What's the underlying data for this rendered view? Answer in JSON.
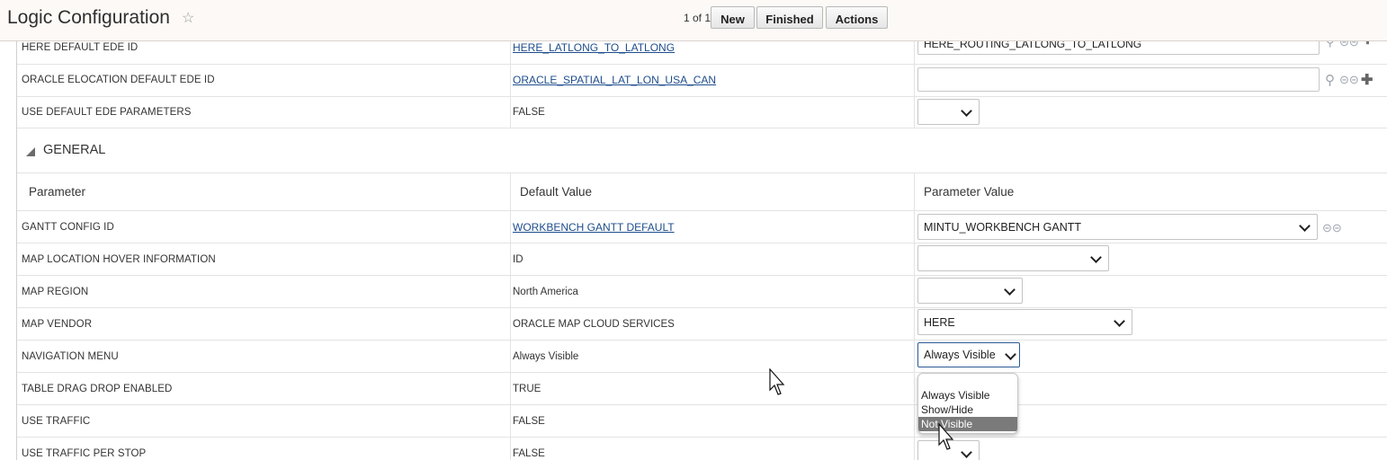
{
  "header": {
    "title": "Logic Configuration",
    "pager": "1 of 1",
    "buttons": {
      "new": "New",
      "finished": "Finished",
      "actions": "Actions"
    }
  },
  "top_rows": [
    {
      "param": "HERE DEFAULT EDE ID",
      "default": "HERE_LATLONG_TO_LATLONG",
      "value": "HERE_ROUTING_LATLONG_TO_LATLONG"
    },
    {
      "param": "ORACLE ELOCATION DEFAULT EDE ID",
      "default": "ORACLE_SPATIAL_LAT_LON_USA_CAN",
      "value": ""
    },
    {
      "param": "USE DEFAULT EDE PARAMETERS",
      "default": "FALSE",
      "value": ""
    }
  ],
  "section": {
    "title": "GENERAL",
    "columns": {
      "param": "Parameter",
      "default": "Default Value",
      "value": "Parameter Value"
    }
  },
  "rows": [
    {
      "param": "GANTT CONFIG ID",
      "default": "WORKBENCH GANTT DEFAULT",
      "value": "MINTU_WORKBENCH GANTT"
    },
    {
      "param": "MAP LOCATION HOVER INFORMATION",
      "default": "ID",
      "value": ""
    },
    {
      "param": "MAP REGION",
      "default": "North America",
      "value": ""
    },
    {
      "param": "MAP VENDOR",
      "default": "ORACLE MAP CLOUD SERVICES",
      "value": "HERE"
    },
    {
      "param": "NAVIGATION MENU",
      "default": "Always Visible",
      "value": "Always Visible"
    },
    {
      "param": "TABLE DRAG DROP ENABLED",
      "default": "TRUE",
      "value": ""
    },
    {
      "param": "USE TRAFFIC",
      "default": "FALSE",
      "value": ""
    },
    {
      "param": "USE TRAFFIC PER STOP",
      "default": "FALSE",
      "value": ""
    }
  ],
  "dropdown_options": [
    "Always Visible",
    "Show/Hide",
    "Not Visible"
  ],
  "highlighted_option": "Not Visible",
  "icons": [
    "star-icon",
    "search-icon",
    "glasses-icon",
    "plus-icon",
    "chevron-down-icon",
    "collapse-triangle-icon",
    "mouse-pointer-icon"
  ],
  "colors": {
    "link": "#1e4d8c",
    "header_bg": "#fcf9f6",
    "highlight": "#7a7a7a"
  }
}
